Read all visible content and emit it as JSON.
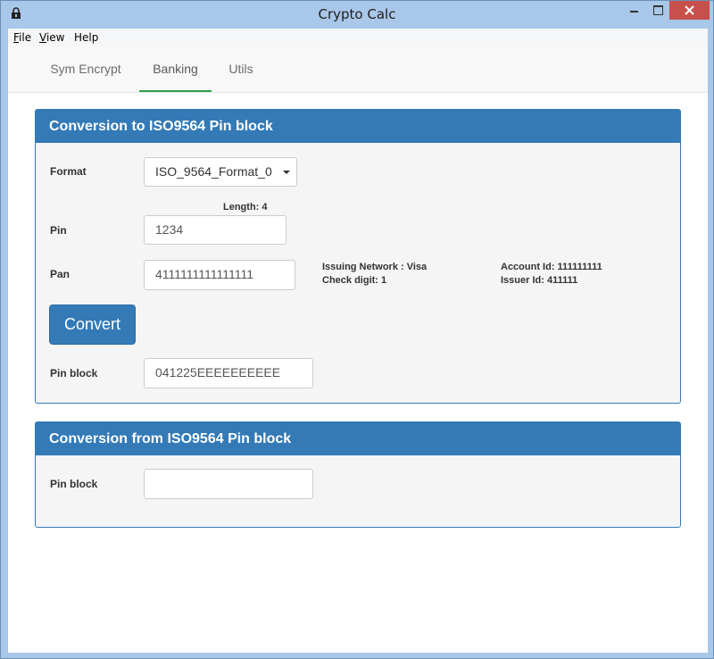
{
  "window": {
    "title": "Crypto Calc"
  },
  "menu": {
    "file": "File",
    "file_ul": "F",
    "file_rest": "ile",
    "view": "View",
    "view_ul": "V",
    "view_rest": "iew",
    "help": "Help"
  },
  "tabs": [
    {
      "label": "Sym Encrypt",
      "active": false
    },
    {
      "label": "Banking",
      "active": true
    },
    {
      "label": "Utils",
      "active": false
    }
  ],
  "to_panel": {
    "title": "Conversion to ISO9564 Pin block",
    "format_label": "Format",
    "format_value": "ISO_9564_Format_0",
    "length_text": "Length: 4",
    "pin_label": "Pin",
    "pin_value": "1234",
    "pan_label": "Pan",
    "pan_value": "4111111111111111",
    "issuing_network": "Issuing Network : Visa",
    "check_digit": "Check digit: 1",
    "account_id": "Account Id: 111111111",
    "issuer_id": "Issuer Id: 411111",
    "convert_label": "Convert",
    "pinblock_label": "Pin block",
    "pinblock_value": "041225EEEEEEEEEE"
  },
  "from_panel": {
    "title": "Conversion from ISO9564 Pin block",
    "pinblock_label": "Pin block",
    "pinblock_value": ""
  },
  "colors": {
    "accent": "#337ab7",
    "active_tab": "#2ca24a",
    "close": "#c7504a"
  }
}
